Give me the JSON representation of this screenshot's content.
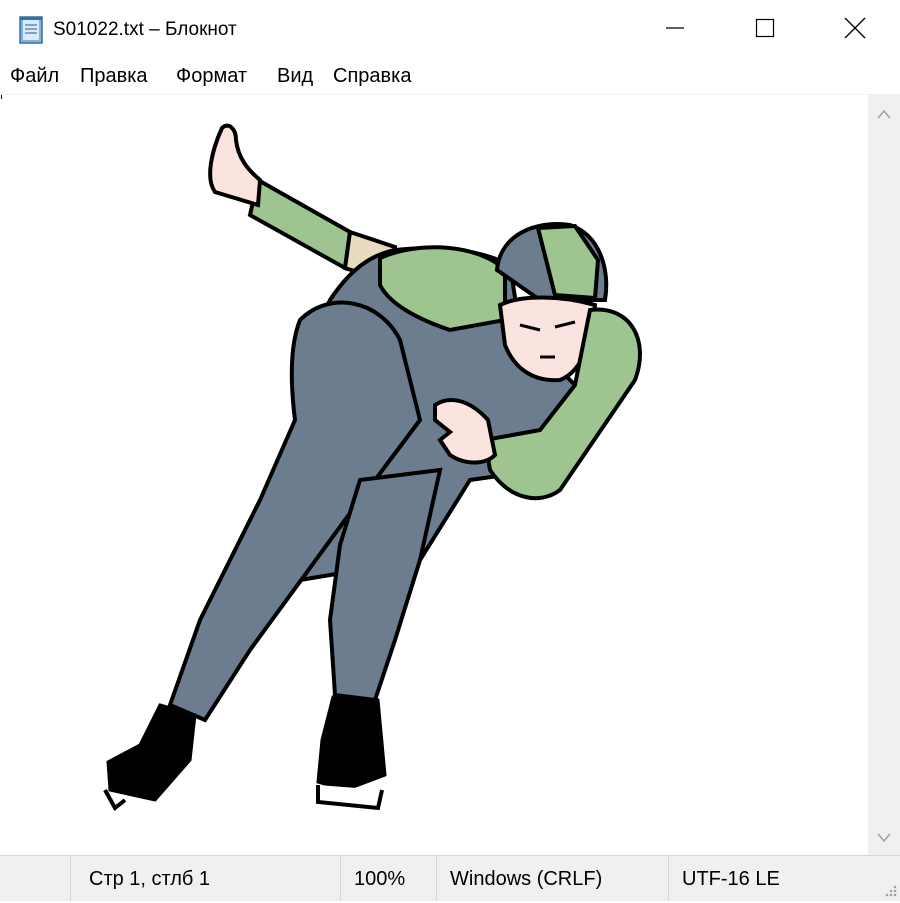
{
  "window": {
    "title": "S01022.txt – Блокнот",
    "icon": "notepad-icon",
    "controls": [
      "minimize-icon",
      "maximize-icon",
      "close-icon"
    ]
  },
  "menu": {
    "file": "Файл",
    "edit": "Правка",
    "format": "Формат",
    "view": "Вид",
    "help": "Справка"
  },
  "editor": {
    "content_kind": "image",
    "image_subject_icon": "speed-skater-illustration",
    "colors": {
      "suit": "#6b7d8f",
      "sleeves": "#9ec48f",
      "skin": "#fbe3df",
      "outline": "#000000"
    }
  },
  "status": {
    "position": "Стр 1, стлб 1",
    "zoom": "100%",
    "line_ending": "Windows (CRLF)",
    "encoding": "UTF-16 LE"
  }
}
